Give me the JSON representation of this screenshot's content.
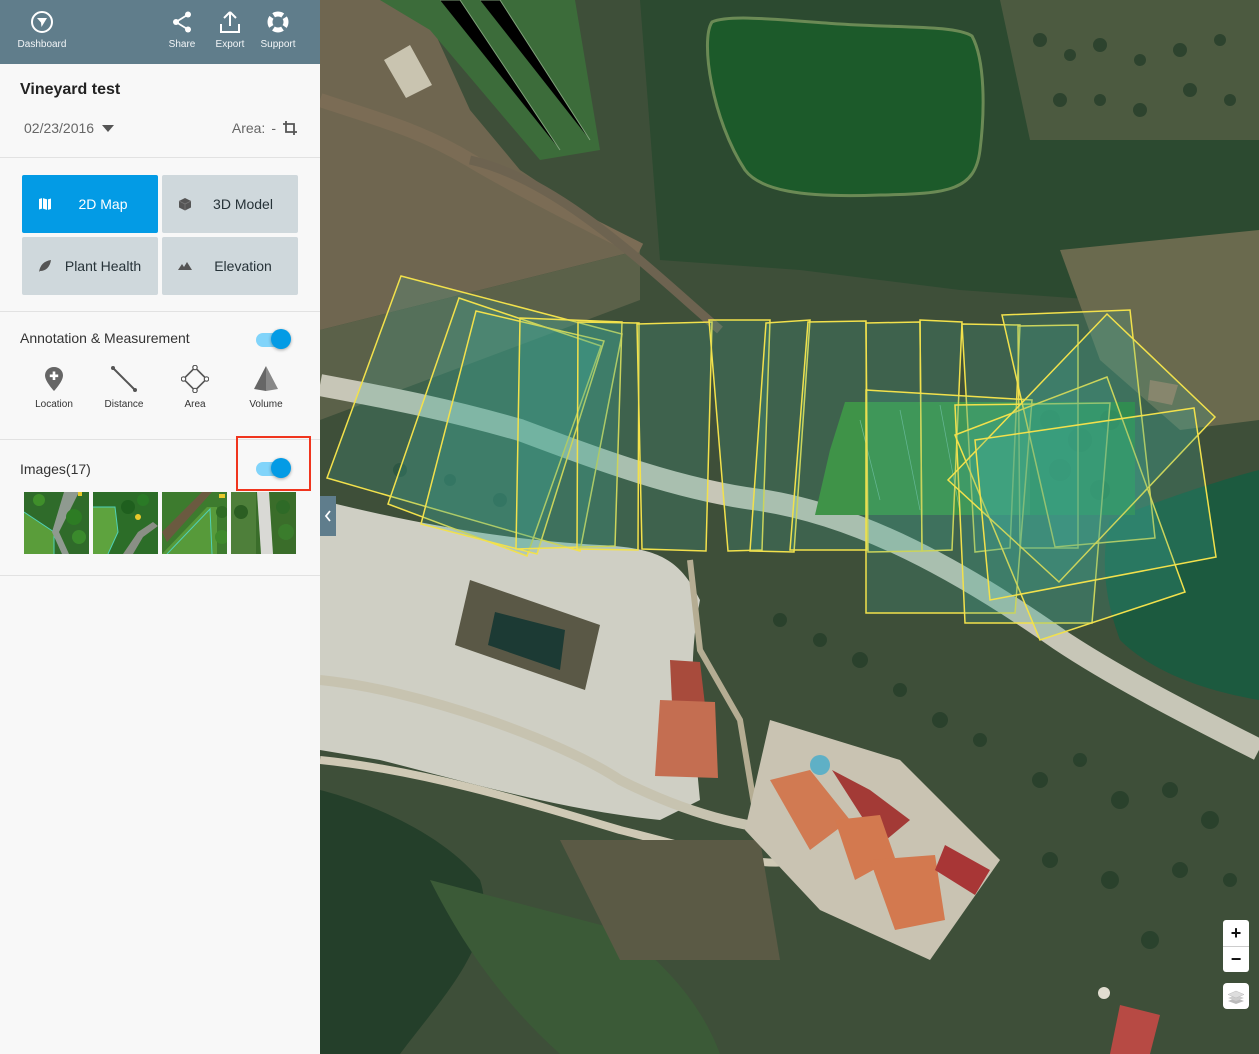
{
  "topbar": {
    "dashboard": {
      "label": "Dashboard",
      "icon": "dashboard-compass-icon"
    },
    "share": {
      "label": "Share",
      "icon": "share-icon"
    },
    "export": {
      "label": "Export",
      "icon": "export-icon"
    },
    "support": {
      "label": "Support",
      "icon": "lifebuoy-icon"
    }
  },
  "project": {
    "title": "Vineyard test",
    "date": "02/23/2016",
    "area_label": "Area:",
    "area_value": "-"
  },
  "views": [
    {
      "label": "2D Map",
      "icon": "map-icon",
      "active": true
    },
    {
      "label": "3D Model",
      "icon": "cube-icon",
      "active": false
    },
    {
      "label": "Plant Health",
      "icon": "leaf-icon",
      "active": false
    },
    {
      "label": "Elevation",
      "icon": "mountain-icon",
      "active": false
    }
  ],
  "annotation": {
    "title": "Annotation & Measurement",
    "enabled": true,
    "tools": [
      {
        "label": "Location",
        "icon": "location-pin-icon"
      },
      {
        "label": "Distance",
        "icon": "distance-line-icon"
      },
      {
        "label": "Area",
        "icon": "area-polygon-icon"
      },
      {
        "label": "Volume",
        "icon": "volume-pyramid-icon"
      }
    ]
  },
  "images": {
    "title": "Images(17)",
    "count": 17,
    "enabled": true,
    "visible_thumbnails": 4
  },
  "map": {
    "zoom_in_label": "+",
    "zoom_out_label": "−",
    "footprint_color": "#f2e14c",
    "footprint_count": 17
  },
  "colors": {
    "topbar": "#607d8b",
    "accent": "#039be5",
    "highlight": "#f0351e"
  }
}
